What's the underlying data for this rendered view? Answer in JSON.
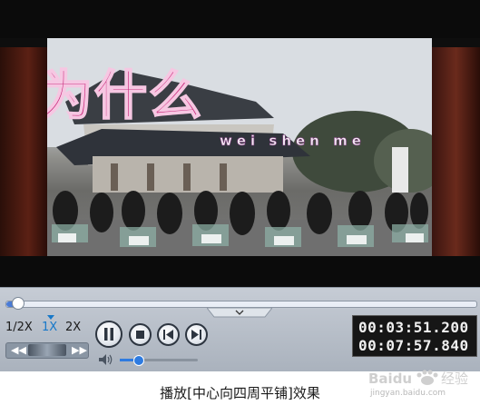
{
  "video": {
    "lyric_text": "为什么",
    "pinyin_text": "wei shen me"
  },
  "controls": {
    "speed_options": [
      "1/2X",
      "1X",
      "2X"
    ],
    "speed_selected": "1X",
    "seek_progress": 0.012,
    "volume_level": 0.23,
    "current_time": "00:03:51.200",
    "total_time": "00:07:57.840",
    "icons": {
      "rewind": "rewind-icon",
      "fast_forward": "fast-forward-icon",
      "pause": "pause-icon",
      "stop": "stop-icon",
      "previous": "previous-icon",
      "next": "next-icon",
      "volume": "speaker-icon",
      "collapse": "chevron-down-icon"
    }
  },
  "caption": "播放[中心向四周平铺]效果",
  "watermark": {
    "logo_text": "Baidu经验",
    "url": "jingyan.baidu.com"
  },
  "colors": {
    "accent": "#1778c9",
    "lyric": "#c8287a",
    "controls_bg": "#b7bec8"
  }
}
